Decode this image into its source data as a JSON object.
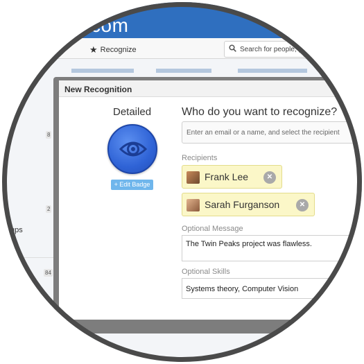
{
  "header": {
    "logo_fragment": "com"
  },
  "toolbar": {
    "recognize_label": "Recognize",
    "search_placeholder": "Search for people, g"
  },
  "background": {
    "badges": [
      "8",
      "2",
      "84"
    ],
    "side_text": "ups"
  },
  "modal": {
    "title": "New Recognition",
    "badge": {
      "name": "Detailed",
      "edit_label": "+ Edit Badge",
      "color": "#2f63d6",
      "icon": "eye-icon"
    },
    "question": "Who do you want to recognize?",
    "recipient_placeholder": "Enter an email or a name, and select the recipient",
    "recipients_label": "Recipients",
    "recipients": [
      {
        "name": "Frank Lee",
        "remove_icon": "close-icon"
      },
      {
        "name": "Sarah Furganson",
        "remove_icon": "close-icon"
      }
    ],
    "message_label": "Optional Message",
    "message_value": "The Twin Peaks project was flawless.",
    "skills_label": "Optional Skills",
    "skills_value": "Systems theory, Computer Vision"
  },
  "colors": {
    "header_blue": "#2f6fbf",
    "chip_yellow": "#fbf7c8",
    "edit_badge_blue": "#6fb6ec"
  }
}
